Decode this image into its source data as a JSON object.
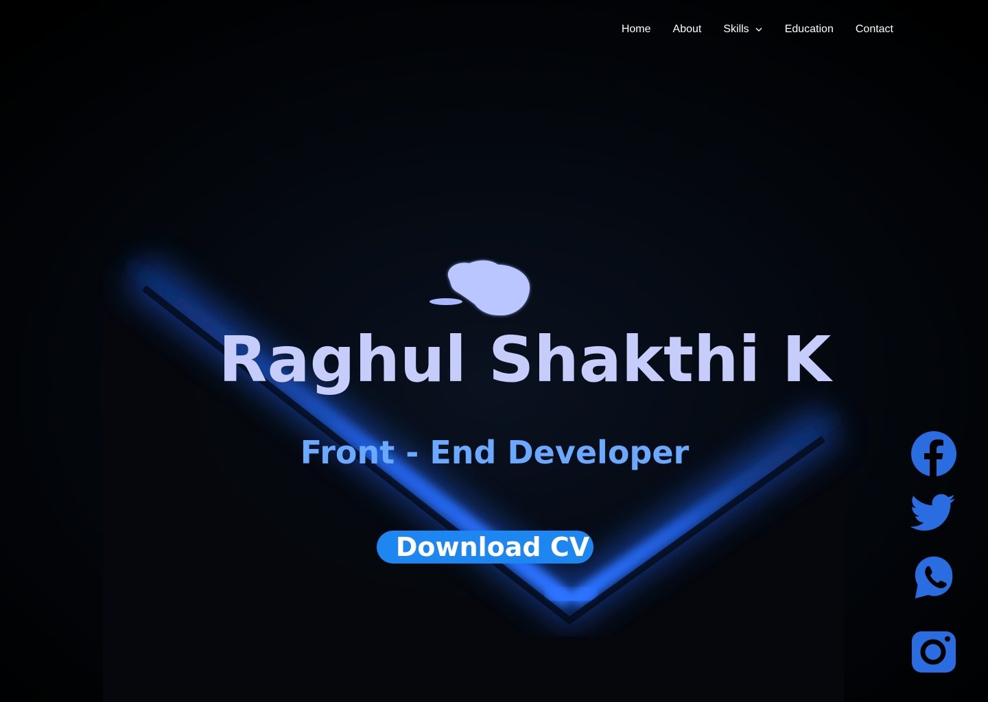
{
  "nav": {
    "items": [
      {
        "label": "Home"
      },
      {
        "label": "About"
      },
      {
        "label": "Skills",
        "has_dropdown": true
      },
      {
        "label": "Education"
      },
      {
        "label": "Contact"
      }
    ]
  },
  "hero": {
    "name": "Raghul Shakthi K",
    "role": "Front - End Developer",
    "cv_button_label": "Download CV"
  },
  "social": {
    "icons": [
      "facebook-icon",
      "twitter-icon",
      "whatsapp-icon",
      "instagram-icon"
    ]
  },
  "colors": {
    "name_text": "#c7cdfb",
    "role_text": "#6aa9ff",
    "button_bg": "#1d86f0",
    "social_icon": "#2a6de0",
    "glow_blue": "#1c5fd6"
  }
}
